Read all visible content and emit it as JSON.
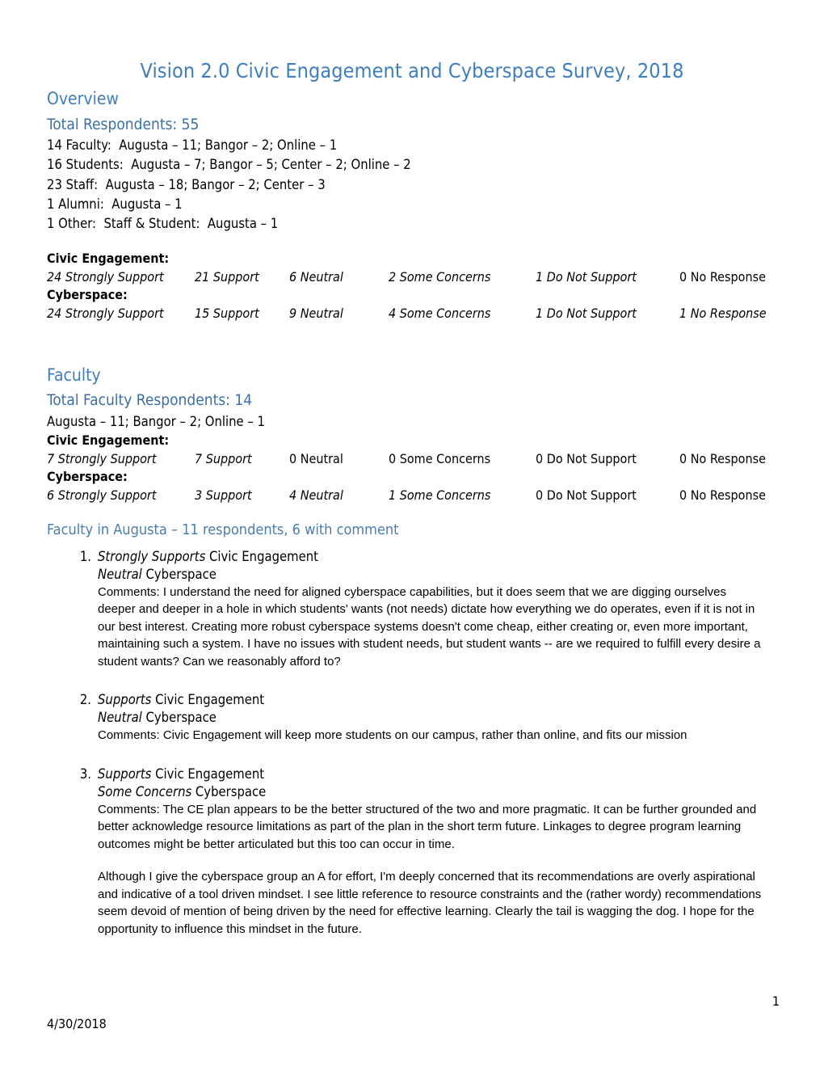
{
  "document": {
    "title": "Vision 2.0 Civic Engagement and Cyberspace Survey, 2018",
    "footer_date": "4/30/2018",
    "page_number": "1",
    "heading_color": "#3F7EBD",
    "subheading_color": "#4C7CB0"
  },
  "overview": {
    "heading": "Overview",
    "total_respondents": "Total Respondents:  55",
    "breakdown": [
      "14 Faculty:  Augusta – 11; Bangor – 2; Online – 1",
      "16 Students:  Augusta – 7; Bangor – 5; Center – 2; Online – 2",
      "23 Staff:  Augusta – 18; Bangor – 2; Center – 3",
      "1 Alumni:  Augusta – 1",
      "1 Other:  Staff & Student:  Augusta – 1"
    ],
    "civic_label": "Civic Engagement:",
    "civic_row": [
      {
        "text": "24 Strongly Support",
        "italic": true
      },
      {
        "text": "21 Support",
        "italic": true
      },
      {
        "text": "6 Neutral",
        "italic": true
      },
      {
        "text": "2 Some Concerns",
        "italic": true
      },
      {
        "text": "1 Do Not Support",
        "italic": true
      },
      {
        "text": "0 No Response",
        "italic": false
      }
    ],
    "cyber_label": "Cyberspace:",
    "cyber_row": [
      {
        "text": "24 Strongly Support",
        "italic": true
      },
      {
        "text": "15 Support",
        "italic": true
      },
      {
        "text": "9 Neutral",
        "italic": true
      },
      {
        "text": "4 Some Concerns",
        "italic": true
      },
      {
        "text": "1 Do Not Support",
        "italic": true
      },
      {
        "text": "1 No Response",
        "italic": true
      }
    ]
  },
  "faculty": {
    "heading": "Faculty",
    "total": "Total Faculty Respondents:  14",
    "locations": "Augusta – 11; Bangor – 2; Online – 1",
    "civic_label": "Civic Engagement:",
    "civic_row": [
      {
        "text": "7 Strongly Support",
        "italic": true
      },
      {
        "text": "7 Support",
        "italic": true
      },
      {
        "text": "0 Neutral",
        "italic": false
      },
      {
        "text": "0 Some Concerns",
        "italic": false
      },
      {
        "text": "0 Do Not Support",
        "italic": false
      },
      {
        "text": "0 No Response",
        "italic": false
      }
    ],
    "cyber_label": "Cyberspace:",
    "cyber_row": [
      {
        "text": "6 Strongly Support",
        "italic": true
      },
      {
        "text": "3 Support",
        "italic": true
      },
      {
        "text": "4 Neutral",
        "italic": true
      },
      {
        "text": "1 Some Concerns",
        "italic": true
      },
      {
        "text": "0 Do Not Support",
        "italic": false
      },
      {
        "text": "0 No Response",
        "italic": false
      }
    ],
    "augusta_heading": "Faculty in Augusta – 11 respondents, 6 with comment",
    "comments": [
      {
        "number": "1.",
        "civic_stance": "Strongly Supports",
        "civic_topic": " Civic Engagement",
        "cyber_stance": "Neutral",
        "cyber_topic": " Cyberspace",
        "paragraphs": [
          "Comments:  I understand the need for aligned cyberspace capabilities, but it does seem that we are digging ourselves deeper and deeper in a hole in which students' wants (not needs) dictate how everything we do operates, even if it is not in our best interest. Creating more robust cyberspace systems doesn't come cheap, either creating or, even more important, maintaining such a system. I have no issues with student needs, but student wants -- are we required to fulfill every desire a student wants? Can we reasonably afford to?"
        ]
      },
      {
        "number": "2.",
        "civic_stance": "Supports",
        "civic_topic": " Civic Engagement",
        "cyber_stance": "Neutral",
        "cyber_topic": " Cyberspace",
        "paragraphs": [
          "Comments:  Civic Engagement will keep more students on our campus, rather than online, and fits our mission"
        ]
      },
      {
        "number": "3.",
        "civic_stance": "Supports",
        "civic_topic": " Civic Engagement",
        "cyber_stance": "Some Concerns",
        "cyber_topic": " Cyberspace",
        "paragraphs": [
          "Comments:  The CE plan appears to be the better structured of the two and more pragmatic. It can be further grounded and better acknowledge resource limitations as part of the plan in the short term future. Linkages to degree program learning outcomes might be better articulated but this too can occur in time.",
          "Although I give the cyberspace group an A for effort, I'm deeply concerned that its recommendations are overly aspirational and indicative of a tool driven mindset. I see little reference to resource constraints and the (rather wordy) recommendations seem devoid of mention of being driven by the need for effective learning. Clearly the tail is wagging the dog. I hope for the opportunity to influence this mindset in the future."
        ]
      }
    ]
  }
}
